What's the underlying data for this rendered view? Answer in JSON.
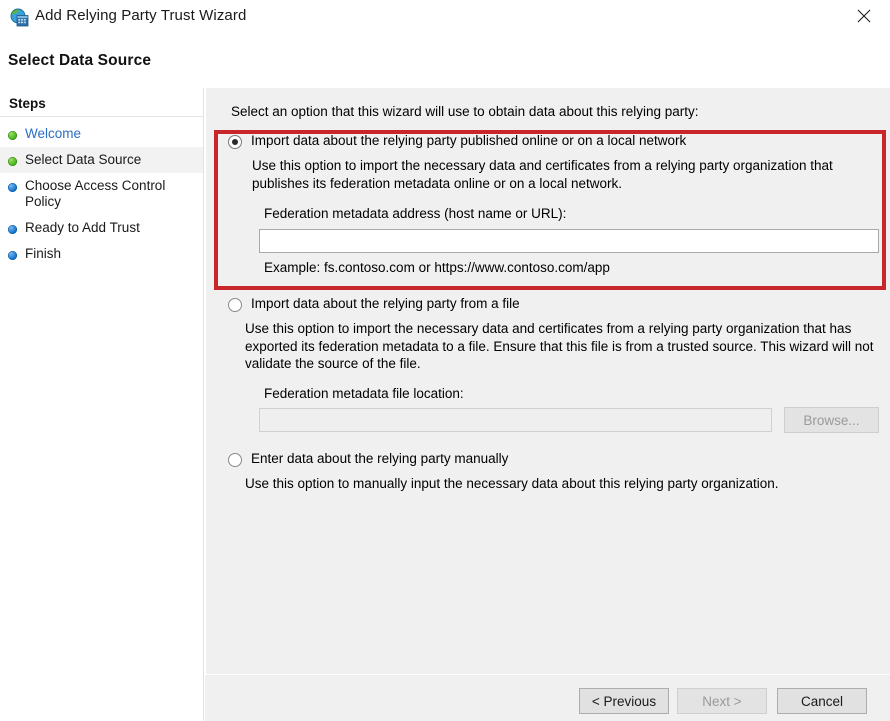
{
  "window": {
    "title": "Add Relying Party Trust Wizard",
    "app_icon": "adfs-globe-server-icon",
    "close_label": "✕"
  },
  "page": {
    "heading": "Select Data Source"
  },
  "sidebar": {
    "heading": "Steps",
    "items": [
      {
        "label": "Welcome",
        "state": "completed",
        "bullet": "green",
        "is_link": true,
        "current": false
      },
      {
        "label": "Select Data Source",
        "state": "current",
        "bullet": "green",
        "is_link": false,
        "current": true
      },
      {
        "label": "Choose Access Control Policy",
        "state": "pending",
        "bullet": "blue",
        "is_link": false,
        "current": false
      },
      {
        "label": "Ready to Add Trust",
        "state": "pending",
        "bullet": "blue",
        "is_link": false,
        "current": false
      },
      {
        "label": "Finish",
        "state": "pending",
        "bullet": "blue",
        "is_link": false,
        "current": false
      }
    ]
  },
  "main": {
    "intro": "Select an option that this wizard will use to obtain data about this relying party:",
    "options": [
      {
        "id": "import-online",
        "title": "Import data about the relying party published online or on a local network",
        "description": "Use this option to import the necessary data and certificates from a relying party organization that publishes its federation metadata online or on a local network.",
        "selected": true,
        "field_label": "Federation metadata address (host name or URL):",
        "field_value": "",
        "field_placeholder": "",
        "field_disabled": false,
        "hint": "Example: fs.contoso.com or https://www.contoso.com/app"
      },
      {
        "id": "import-file",
        "title": "Import data about the relying party from a file",
        "description": "Use this option to import the necessary data and certificates from a relying party organization that has exported its federation metadata to a file. Ensure that this file is from a trusted source.  This wizard will not validate the source of the file.",
        "selected": false,
        "field_label": "Federation metadata file location:",
        "field_value": "",
        "field_placeholder": "",
        "field_disabled": true,
        "browse_label": "Browse...",
        "browse_disabled": true
      },
      {
        "id": "manual",
        "title": "Enter data about the relying party manually",
        "description": "Use this option to manually input the necessary data about this relying party organization.",
        "selected": false
      }
    ]
  },
  "annotation": {
    "color": "#c9262c",
    "target": "import-online-option"
  },
  "footer": {
    "previous_label": "< Previous",
    "next_label": "Next >",
    "next_disabled": true,
    "cancel_label": "Cancel"
  }
}
